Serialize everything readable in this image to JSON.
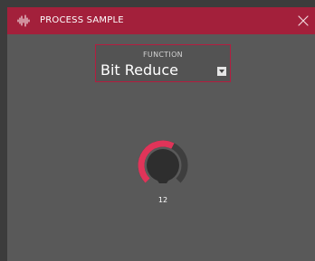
{
  "header": {
    "title": "PROCESS SAMPLE",
    "icon": "waveform-icon",
    "close_icon": "close-icon"
  },
  "function_select": {
    "label": "FUNCTION",
    "value": "Bit Reduce"
  },
  "knob": {
    "value": "12",
    "fill_fraction": 0.6
  },
  "colors": {
    "accent": "#a3203b",
    "knob_arc": "#e03459",
    "panel": "#595959",
    "background": "#3c3c3c"
  }
}
